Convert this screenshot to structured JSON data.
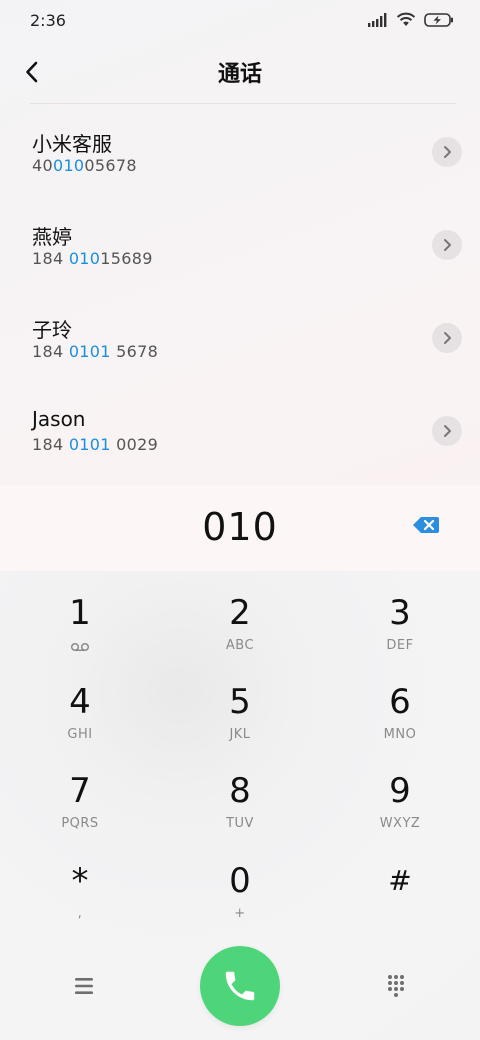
{
  "status_bar": {
    "time": "2:36"
  },
  "header": {
    "title": "通话"
  },
  "contacts": [
    {
      "name": "小米客服",
      "number_pre": "40",
      "number_match": "010",
      "number_post": "05678"
    },
    {
      "name": "燕婷",
      "number_pre": "184 ",
      "number_match": "010",
      "number_post": "15689"
    },
    {
      "name": "子玲",
      "number_pre": "184 ",
      "number_match": "0101",
      "number_post": " 5678"
    },
    {
      "name": "Jason",
      "number_pre": "184 ",
      "number_match": "0101",
      "number_post": " 0029"
    }
  ],
  "dial": {
    "input": "010"
  },
  "keys": [
    {
      "digit": "1",
      "letters": ""
    },
    {
      "digit": "2",
      "letters": "ABC"
    },
    {
      "digit": "3",
      "letters": "DEF"
    },
    {
      "digit": "4",
      "letters": "GHI"
    },
    {
      "digit": "5",
      "letters": "JKL"
    },
    {
      "digit": "6",
      "letters": "MNO"
    },
    {
      "digit": "7",
      "letters": "PQRS"
    },
    {
      "digit": "8",
      "letters": "TUV"
    },
    {
      "digit": "9",
      "letters": "WXYZ"
    },
    {
      "digit": "*",
      "letters": ","
    },
    {
      "digit": "0",
      "letters": "+"
    },
    {
      "digit": "#",
      "letters": ""
    }
  ],
  "colors": {
    "accent": "#1a8fe0",
    "call": "#4fd579",
    "delete": "#2d8ee0"
  },
  "icons": {
    "back": "chevron-left-icon",
    "detail": "chevron-right-icon",
    "delete": "backspace-icon",
    "voicemail": "voicemail-icon",
    "menu": "menu-icon",
    "call": "phone-icon",
    "dialpad": "dialpad-icon"
  }
}
